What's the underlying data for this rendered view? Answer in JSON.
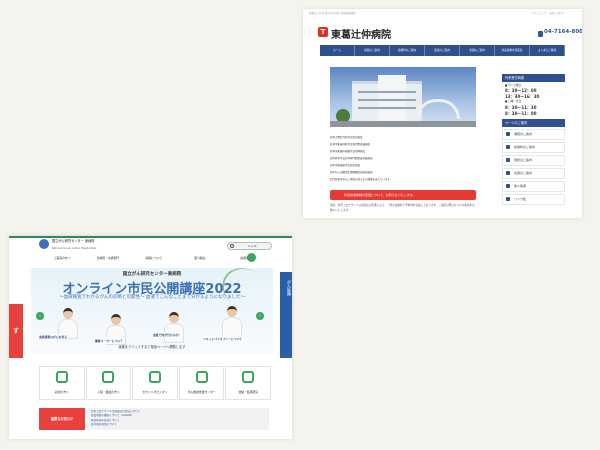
{
  "hospital_right": {
    "topbar_left": "医療法人社団 東葛辻仲病院 地域医療連携",
    "topbar_right": "サイトマップ　お問い合わせ",
    "logo_glyph": "T",
    "title": "東葛辻仲病院",
    "phone": "04-7164-8000",
    "nav": [
      "ホーム",
      "病院のご案内",
      "診療科のご案内",
      "受診のご案内",
      "交通のご案内",
      "外来診療担当医表",
      "よくあるご質問"
    ],
    "lines": [
      "日本大腸肛門病学会認定施設",
      "日本消化器外科学会専門医修練施設",
      "日本消化器内視鏡学会指導施設",
      "日本外科学会外科専門医制度修練施設",
      "日本消化器病学会認定施設",
      "日本がん治療認定医機構認定研修施設"
    ],
    "body_text": "肛門疾患を中心に地域の皆さまの健康を支えています。",
    "alert": "外来診療体制の変更について、お知らせいたします。",
    "note": "現在、新型コロナウイルス感染症の影響により、一部の診療科で予約制を実施しております。ご来院の際はマスクの着用をお願いいたします。",
    "sidebar_heading": "外来受付時間",
    "hours_label_1": "■ 月〜土曜日",
    "hours_1": "8：30〜12：00",
    "hours_2": "13：30〜16：30",
    "hours_label_2": "■ 日曜・祝日",
    "hours_3": "8：30〜11：30",
    "hours_4": "8：30〜11：00",
    "menu_heading": "ページのご案内",
    "menu": [
      "病院のご案内",
      "診療科のご案内",
      "受診のご案内",
      "交通のご案内",
      "求人情報",
      "リンク集"
    ]
  },
  "hospital_left": {
    "title": "国立がん研究センター 東病院",
    "subtitle": "National Cancer Center Hospital East",
    "search_controls": "A A ⚙",
    "nav": [
      "ご来院の方へ",
      "診療科・共通部門",
      "病院について",
      "取り組み",
      "採用情報"
    ],
    "banner_kicker": "国立がん研究センター東病院",
    "banner_headline": "オンライン市民公開講座2022",
    "banner_sub": "〜血液検査でわかるがんの診断と可能性〜 血液でこんなことまで分かるようになりました〜",
    "bubbles": [
      "血液検査はがんを見る",
      "腫瘍マーカーについて",
      "血液で何が分かるの？",
      "リキッドバイオプシーについて"
    ],
    "banner_foot": "画像をクリックすると特設ページへ移動します",
    "arrow_left": "‹",
    "arrow_right": "›",
    "side_left": "す",
    "side_right": "がん医療",
    "quick": [
      "初診の方へ",
      "入院・面会の方へ",
      "セカンドオピニオン",
      "がん相談支援センター",
      "治験・臨床研究"
    ],
    "notice_head": "重要なお知らせ",
    "notices": [
      "新型コロナウイルス感染症の対応について",
      "面会制限の継続について（2022年）",
      "発熱外来の受診について",
      "駐車場の利用について",
      "外来診療のご案内"
    ]
  },
  "colors": {
    "nav_blue": "#2f4f8f",
    "alert_red": "#e33a33",
    "ncc_green": "#3ba55c",
    "ncc_blue": "#3b6fb5"
  }
}
